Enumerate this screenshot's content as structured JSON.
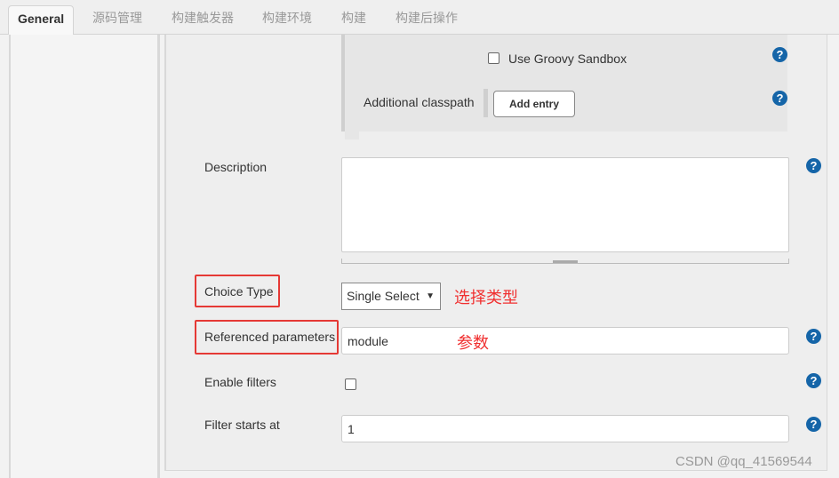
{
  "tabs": [
    {
      "label": "General",
      "active": true
    },
    {
      "label": "源码管理"
    },
    {
      "label": "构建触发器"
    },
    {
      "label": "构建环境"
    },
    {
      "label": "构建"
    },
    {
      "label": "构建后操作"
    }
  ],
  "groovy": {
    "sandbox_label": "Use Groovy Sandbox",
    "sandbox_checked": false,
    "classpath_label": "Additional classpath",
    "add_entry": "Add entry"
  },
  "description": {
    "label": "Description",
    "value": ""
  },
  "choice_type": {
    "label": "Choice Type",
    "value": "Single Select",
    "annotation": "选择类型"
  },
  "referenced": {
    "label": "Referenced parameters",
    "value": "module",
    "annotation": "参数"
  },
  "filters": {
    "label": "Enable filters",
    "checked": false
  },
  "filter_start": {
    "label": "Filter starts at",
    "value": "1"
  },
  "watermark": "CSDN @qq_41569544",
  "colors": {
    "help": "#1565a8",
    "annotation": "#f03030"
  }
}
